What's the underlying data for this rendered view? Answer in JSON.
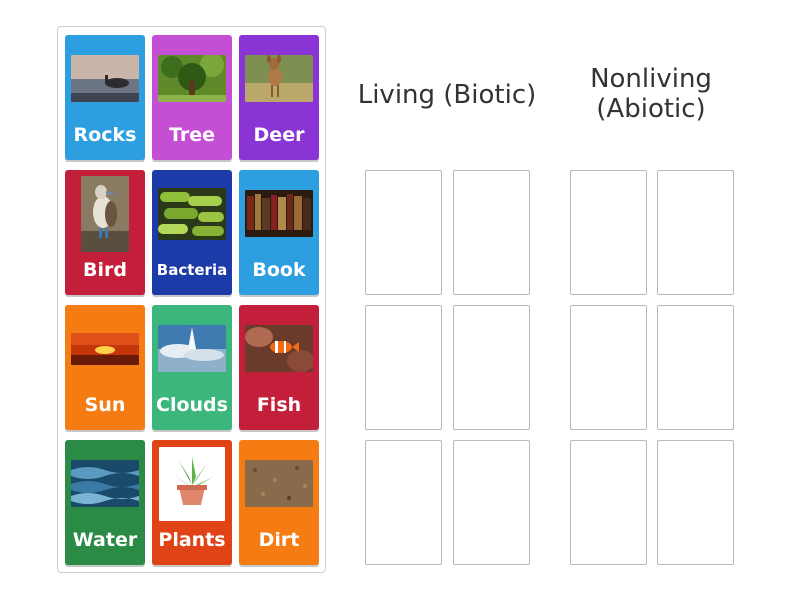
{
  "activity": {
    "cards": [
      {
        "label": "Rocks",
        "color": "#2d9ee0",
        "image": "sunset-rocks-photo"
      },
      {
        "label": "Tree",
        "color": "#c54fd4",
        "image": "tree-photo"
      },
      {
        "label": "Deer",
        "color": "#8a34d6",
        "image": "deer-photo"
      },
      {
        "label": "Bird",
        "color": "#c41f3a",
        "image": "bird-photo"
      },
      {
        "label": "Bacteria",
        "color": "#1c3aa8",
        "image": "bacteria-photo"
      },
      {
        "label": "Book",
        "color": "#2d9ee0",
        "image": "books-photo"
      },
      {
        "label": "Sun",
        "color": "#f57c12",
        "image": "sunset-photo"
      },
      {
        "label": "Clouds",
        "color": "#3bb67c",
        "image": "clouds-photo"
      },
      {
        "label": "Fish",
        "color": "#c41f3a",
        "image": "clownfish-photo"
      },
      {
        "label": "Water",
        "color": "#2a8a46",
        "image": "water-photo"
      },
      {
        "label": "Plants",
        "color": "#e04416",
        "image": "potted-plant-photo"
      },
      {
        "label": "Dirt",
        "color": "#f57c12",
        "image": "dirt-photo"
      }
    ],
    "groups": [
      {
        "title": "Living (Biotic)",
        "slots": 6
      },
      {
        "title": "Nonliving (Abiotic)",
        "slots": 6
      }
    ]
  }
}
